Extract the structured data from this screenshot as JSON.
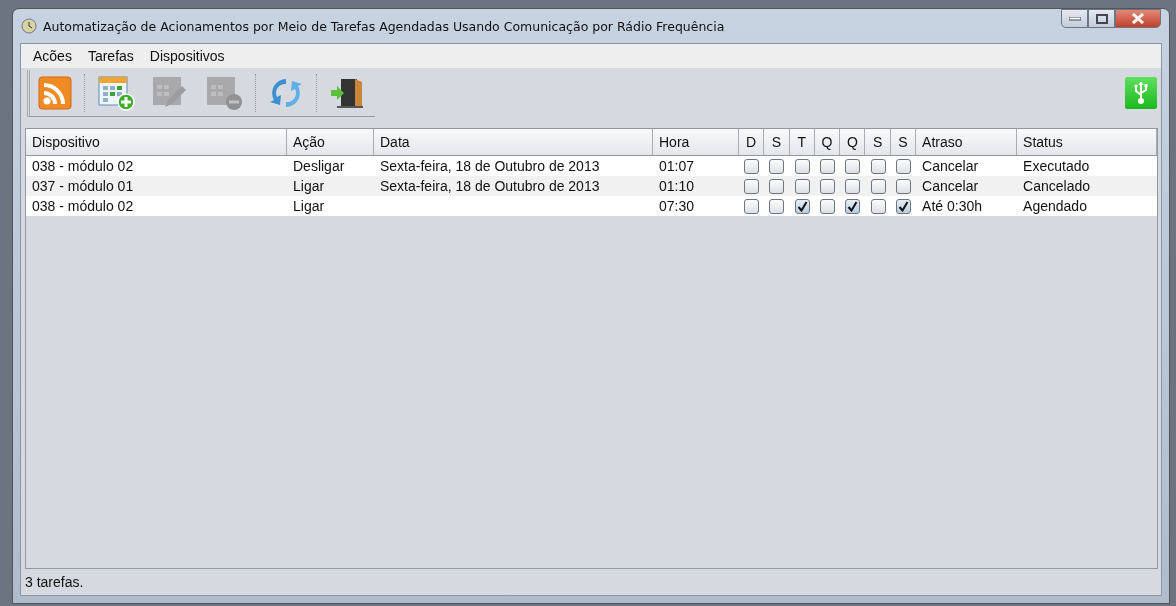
{
  "window": {
    "title": "Automatização de Acionamentos por Meio de Tarefas Agendadas Usando Comunicação por Rádio Frequência"
  },
  "menu": [
    "Acões",
    "Tarefas",
    "Dispositivos"
  ],
  "toolbar": [
    {
      "kind": "rss",
      "disabled": false
    },
    {
      "kind": "add",
      "disabled": false
    },
    {
      "kind": "edit",
      "disabled": true
    },
    {
      "kind": "remove",
      "disabled": true
    },
    {
      "kind": "refresh",
      "disabled": false
    },
    {
      "kind": "exit",
      "disabled": false
    }
  ],
  "table": {
    "columns": [
      "Dispositivo",
      "Ação",
      "Data",
      "Hora",
      "D",
      "S",
      "T",
      "Q",
      "Q",
      "S",
      "S",
      "Atraso",
      "Status"
    ],
    "rows": [
      {
        "device": "038 - módulo 02",
        "action": "Desligar",
        "date": "Sexta-feira, 18 de Outubro de 2013",
        "time": "01:07",
        "days": [
          false,
          false,
          false,
          false,
          false,
          false,
          false
        ],
        "delay": "Cancelar",
        "status": "Executado"
      },
      {
        "device": "037 - módulo 01",
        "action": "Ligar",
        "date": "Sexta-feira, 18 de Outubro de 2013",
        "time": "01:10",
        "days": [
          false,
          false,
          false,
          false,
          false,
          false,
          false
        ],
        "delay": "Cancelar",
        "status": "Cancelado"
      },
      {
        "device": "038 - módulo 02",
        "action": "Ligar",
        "time": "07:30",
        "days": [
          false,
          false,
          true,
          false,
          true,
          false,
          true
        ],
        "delay": "Até 0:30h",
        "status": "Agendado"
      }
    ]
  },
  "status_bar": "3 tarefas."
}
